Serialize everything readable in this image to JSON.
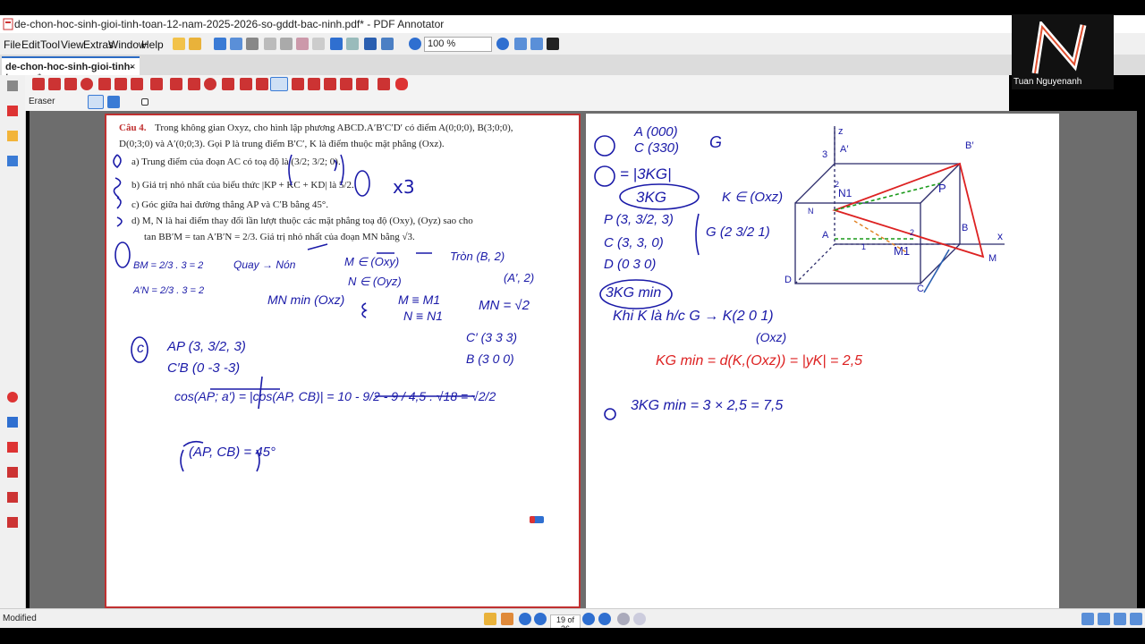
{
  "window": {
    "title": "de-chon-hoc-sinh-gioi-tinh-toan-12-nam-2025-2026-so-gddt-bac-ninh.pdf* - PDF Annotator"
  },
  "menu": {
    "items": [
      "File",
      "Edit",
      "Tool",
      "View",
      "Extras",
      "Window",
      "Help"
    ]
  },
  "toolbar": {
    "zoom": "100 %"
  },
  "tab": {
    "label": "de-chon-hoc-sinh-gioi-tinh-toan-...*",
    "close": "×"
  },
  "tool": {
    "label": "Eraser"
  },
  "webcam": {
    "name": "Tuan Nguyenanh"
  },
  "status": {
    "text": "Modified",
    "page": "19 of 36"
  },
  "page1": {
    "cau": "Câu 4.",
    "line1": "Trong không gian Oxyz, cho hình lập phương ABCD.A′B′C′D′ có điểm A(0;0;0), B(3;0;0),",
    "line2": "D(0;3;0) và A′(0;0;3). Gọi P là trung điểm B′C′, K là điểm thuộc mặt phẳng (Oxz).",
    "a": "a) Trung điểm của đoạn AC có toạ độ là (3/2; 3/2; 0).",
    "b": "b) Giá trị nhỏ nhất của biểu thức |KP + KC + KD| là 5/2.",
    "c": "c) Góc giữa hai đường thẳng AP và C′B bằng 45°.",
    "d1": "d) M, N là hai điểm thay đổi lần lượt thuộc các mặt phẳng toạ độ (Oxy), (Oyz) sao cho",
    "d2": "tan BB′M = tan A′B′N = 2/3. Giá trị nhỏ nhất của đoạn MN bằng √3."
  },
  "handwriting": {
    "p1_x3": "x3",
    "p1_bm": "BM = 2/3 . 3 = 2",
    "p1_an": "A′N = 2/3 . 3 = 2",
    "p1_quay": "Quay → Nón",
    "p1_mg": "M ∈ (Oxy)",
    "p1_ng": "N ∈ (Oyz)",
    "p1_tron": "Tròn (B, 2)",
    "p1_tron2": "(A′, 2)",
    "p1_mnmin": "MN min (Oxz)",
    "p1_m_m1": "M ≡ M1",
    "p1_n_n1": "N ≡ N1",
    "p1_mn": "MN = √2",
    "p1_c": "c",
    "p1_ap": "AP (3, 3/2, 3)",
    "p1_cb": "C′B (0 -3 -3)",
    "p1_c1": "C′ (3 3 3)",
    "p1_b": "B (3 0 0)",
    "p1_cos": "cos(AP; a′) = |cos(AP, CB)| = 10 - 9/2 - 9 / 4,5 . √18 = √2/2",
    "p1_angle": "(AP, CB) = 45°",
    "p2_a": "A (000)",
    "p2_c": "C (330)",
    "p2_g": "G",
    "p2_b": "= |3KG|",
    "p2_b2": "3KG",
    "p2_k": "K ∈ (Oxz)",
    "p2_p": "P (3, 3/2, 3)",
    "p2_cc": "C (3, 3, 0)",
    "p2_d": "D (0 3 0)",
    "p2_g2": "G (2 3/2 1)",
    "p2_3kg": "3KG min",
    "p2_khi": "Khi K là h/c G → K(2 0 1)",
    "p2_oxz": "(Oxz)",
    "p2_kgmin": "KG min = d(K,(Oxz)) = |yK| = 2,5",
    "p2_final": "3KG min = 3 × 2,5 = 7,5",
    "p2_cube_labels": [
      "z",
      "A′",
      "B′",
      "3",
      "N1",
      "P",
      "N",
      "2",
      "2",
      "x",
      "A",
      "1",
      "M1",
      "B",
      "M",
      "D",
      "C"
    ]
  }
}
